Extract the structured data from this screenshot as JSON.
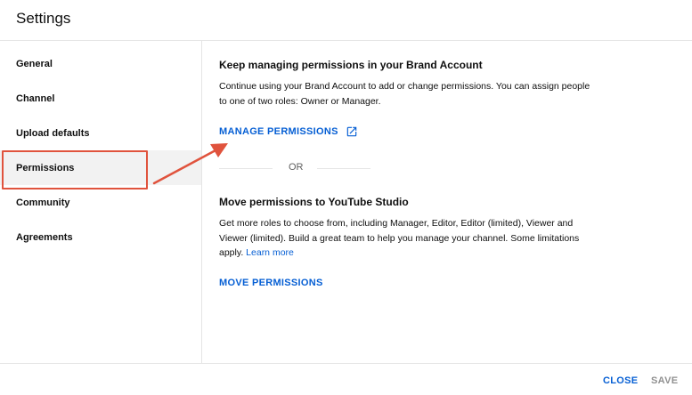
{
  "header": {
    "title": "Settings"
  },
  "sidebar": {
    "items": [
      {
        "label": "General"
      },
      {
        "label": "Channel"
      },
      {
        "label": "Upload defaults"
      },
      {
        "label": "Permissions",
        "selected": true
      },
      {
        "label": "Community"
      },
      {
        "label": "Agreements"
      }
    ]
  },
  "main": {
    "brand_section": {
      "heading": "Keep managing permissions in your Brand Account",
      "body": "Continue using your Brand Account to add or change permissions. You can assign people to one of two roles: Owner or Manager.",
      "action_label": "MANAGE PERMISSIONS",
      "action_icon": "open-in-new-icon"
    },
    "divider_text": "OR",
    "studio_section": {
      "heading": "Move permissions to YouTube Studio",
      "body": "Get more roles to choose from, including Manager, Editor, Editor (limited), Viewer and Viewer (limited). Build a great team to help you manage your channel. Some limitations apply.",
      "learn_more": "Learn more",
      "action_label": "MOVE PERMISSIONS"
    }
  },
  "footer": {
    "close_label": "CLOSE",
    "save_label": "SAVE"
  },
  "colors": {
    "accent": "#065fd4",
    "annotation": "#e0533d",
    "selected_bg": "#f2f2f2",
    "disabled_text": "#909090"
  }
}
